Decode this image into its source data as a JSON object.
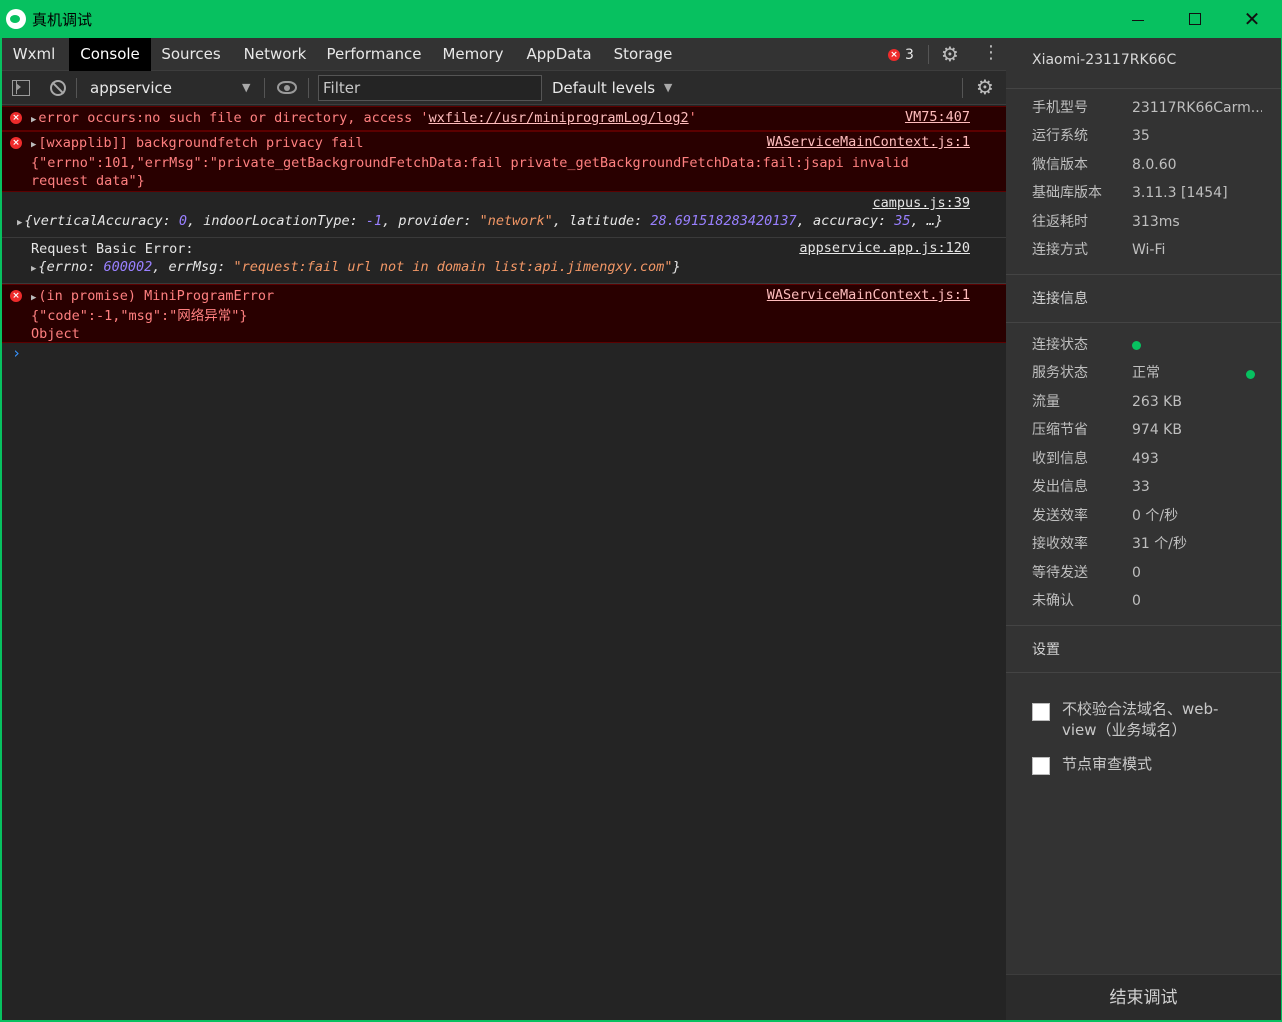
{
  "window": {
    "title": "真机调试",
    "minimize": "",
    "maximize": "",
    "close": "✕"
  },
  "tabs": [
    {
      "label": "Wxml"
    },
    {
      "label": "Console"
    },
    {
      "label": "Sources"
    },
    {
      "label": "Network"
    },
    {
      "label": "Performance"
    },
    {
      "label": "Memory"
    },
    {
      "label": "AppData"
    },
    {
      "label": "Storage"
    }
  ],
  "active_tab": "Console",
  "error_count": "3",
  "toolbar": {
    "context": "appservice",
    "filter_placeholder": "Filter",
    "levels": "Default levels"
  },
  "console": {
    "messages": [
      {
        "level": "error",
        "lines": [
          "error occurs:no such file or directory, access '",
          "wxfile://usr/miniprogramLog/log2",
          "'"
        ],
        "source": "VM75:407"
      },
      {
        "level": "error",
        "lines": [
          "[wxapplib]] backgroundfetch privacy fail",
          "{\"errno\":101,\"errMsg\":\"private_getBackgroundFetchData:fail private_getBackgroundFetchData:fail:jsapi invalid",
          "request data\"}"
        ],
        "source": "WAServiceMainContext.js:1"
      },
      {
        "level": "log",
        "source": "campus.js:39",
        "object": {
          "open": "{",
          "k1": "verticalAccuracy: ",
          "v1": "0",
          "k2": "indoorLocationType: ",
          "v2": "-1",
          "k3": "provider: ",
          "v3": "\"network\"",
          "k4": "latitude: ",
          "v4": "28.691518283420137",
          "k5": "accuracy: ",
          "v5": "35",
          "close": ", …}"
        }
      },
      {
        "level": "log",
        "title": "Request Basic Error:",
        "source": "appservice.app.js:120",
        "object": {
          "open": "{",
          "k1": "errno: ",
          "v1": "600002",
          "k2": "errMsg: ",
          "v2": "\"request:fail url not in domain list:api.jimengxy.com\"",
          "close": "}"
        }
      },
      {
        "level": "error",
        "lines": [
          "(in promise) MiniProgramError",
          "{\"code\":-1,\"msg\":\"网络异常\"}",
          "Object"
        ],
        "source": "WAServiceMainContext.js:1"
      }
    ],
    "prompt": "›"
  },
  "panel": {
    "device_name": "Xiaomi-23117RK66C",
    "device_info": [
      {
        "label": "手机型号",
        "value": "23117RK66Carm..."
      },
      {
        "label": "运行系统",
        "value": "35"
      },
      {
        "label": "微信版本",
        "value": "8.0.60"
      },
      {
        "label": "基础库版本",
        "value": "3.11.3 [1454]"
      },
      {
        "label": "往返耗时",
        "value": "313ms"
      },
      {
        "label": "连接方式",
        "value": "Wi-Fi"
      }
    ],
    "connection_title": "连接信息",
    "connection_info": [
      {
        "label": "连接状态",
        "value": ""
      },
      {
        "label": "服务状态",
        "value": "正常"
      },
      {
        "label": "流量",
        "value": "263 KB"
      },
      {
        "label": "压缩节省",
        "value": "974 KB"
      },
      {
        "label": "收到信息",
        "value": "493"
      },
      {
        "label": "发出信息",
        "value": "33"
      },
      {
        "label": "发送效率",
        "value": "0 个/秒"
      },
      {
        "label": "接收效率",
        "value": "31 个/秒"
      },
      {
        "label": "等待发送",
        "value": "0"
      },
      {
        "label": "未确认",
        "value": "0"
      }
    ],
    "settings_title": "设置",
    "settings": [
      {
        "label": "不校验合法域名、web-view（业务域名）",
        "checked": false
      },
      {
        "label": "节点审查模式",
        "checked": false
      }
    ],
    "end_button": "结束调试"
  },
  "colors": {
    "accent": "#07c160",
    "error_text": "#ff8080",
    "error_bg": "#290000",
    "number": "#9980ff",
    "string": "#f29766"
  }
}
